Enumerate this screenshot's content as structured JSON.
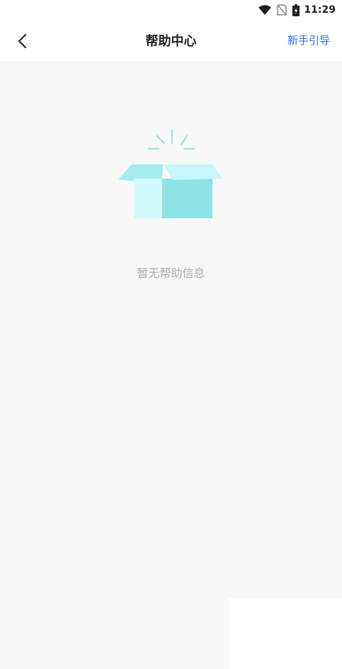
{
  "status_bar": {
    "time": "11:29",
    "icons": [
      "wifi-icon",
      "no-sim-icon",
      "battery-icon"
    ]
  },
  "header": {
    "back_icon": "chevron-left-icon",
    "title": "帮助中心",
    "guide_link": "新手引导"
  },
  "main": {
    "empty_illustration": "empty-box-icon",
    "empty_message": "暂无帮助信息"
  },
  "colors": {
    "link": "#2f6fd6",
    "title": "#222222",
    "empty_text": "#a7adb6",
    "box_light": "#c9f8fb",
    "box_dark": "#8fe1e6",
    "background": "#f8f8f8"
  }
}
